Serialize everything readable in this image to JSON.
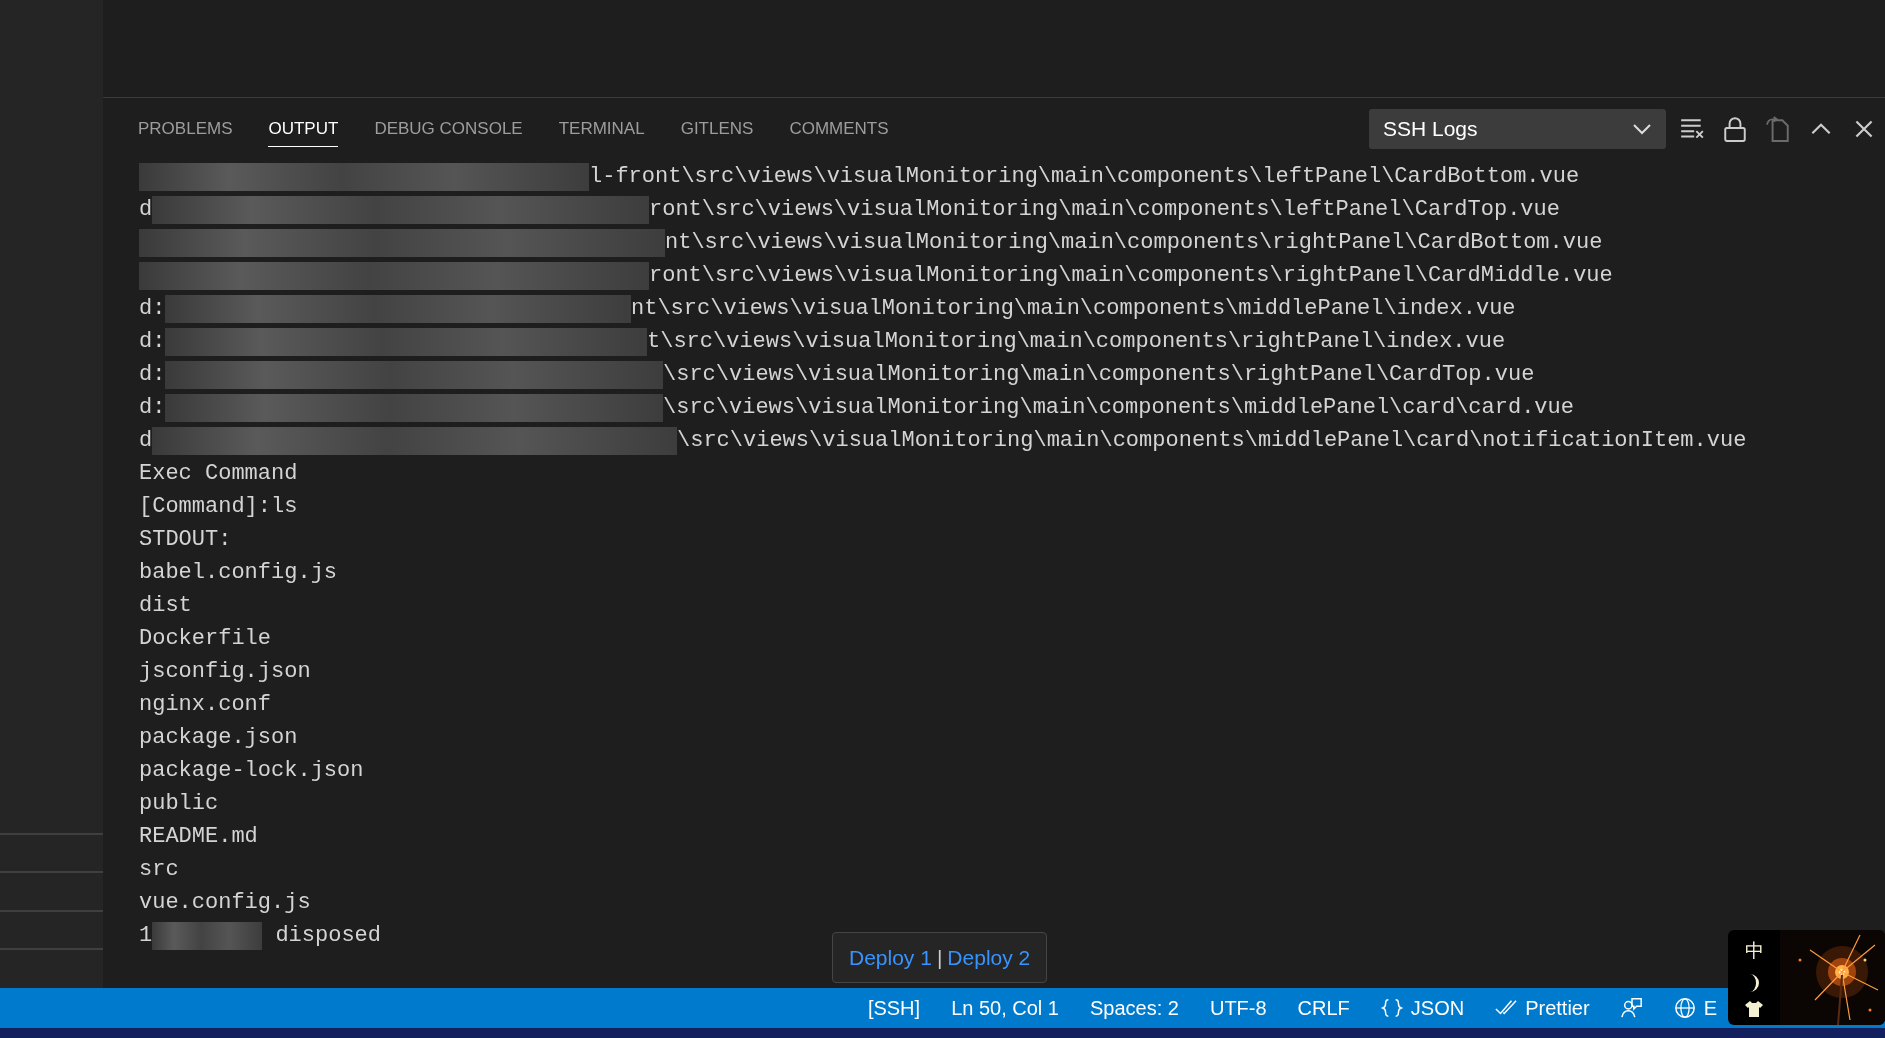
{
  "panel": {
    "tabs": [
      {
        "label": "PROBLEMS",
        "selected": false
      },
      {
        "label": "OUTPUT",
        "selected": true
      },
      {
        "label": "DEBUG CONSOLE",
        "selected": false
      },
      {
        "label": "TERMINAL",
        "selected": false
      },
      {
        "label": "GITLENS",
        "selected": false
      },
      {
        "label": "COMMENTS",
        "selected": false
      }
    ],
    "channel_select": {
      "value": "SSH Logs"
    },
    "actions": [
      {
        "kind": "clear",
        "disabled": false
      },
      {
        "kind": "lock",
        "disabled": false
      },
      {
        "kind": "open-editor",
        "disabled": true
      },
      {
        "kind": "maximize",
        "disabled": false
      },
      {
        "kind": "close",
        "disabled": false
      }
    ]
  },
  "output": [
    {
      "redacted": true,
      "text": "l-front\\src\\views\\visualMonitoring\\main\\components\\leftPanel\\CardBottom.vue"
    },
    {
      "prefix": "d",
      "redacted": true,
      "text": "ront\\src\\views\\visualMonitoring\\main\\components\\leftPanel\\CardTop.vue"
    },
    {
      "redacted": true,
      "text": "nt\\src\\views\\visualMonitoring\\main\\components\\rightPanel\\CardBottom.vue"
    },
    {
      "redacted": true,
      "text": "ront\\src\\views\\visualMonitoring\\main\\components\\rightPanel\\CardMiddle.vue"
    },
    {
      "prefix": "d:",
      "redacted": true,
      "text": "nt\\src\\views\\visualMonitoring\\main\\components\\middlePanel\\index.vue"
    },
    {
      "prefix": "d:",
      "redacted": true,
      "text": "t\\src\\views\\visualMonitoring\\main\\components\\rightPanel\\index.vue"
    },
    {
      "prefix": "d:",
      "redacted": true,
      "text": "\\src\\views\\visualMonitoring\\main\\components\\rightPanel\\CardTop.vue"
    },
    {
      "prefix": "d:",
      "redacted": true,
      "text": "\\src\\views\\visualMonitoring\\main\\components\\middlePanel\\card\\card.vue"
    },
    {
      "prefix": "d",
      "redacted": true,
      "text": "\\src\\views\\visualMonitoring\\main\\components\\middlePanel\\card\\notificationItem.vue"
    },
    {
      "redacted": false,
      "text": "Exec Command"
    },
    {
      "redacted": false,
      "text": "[Command]:ls"
    },
    {
      "redacted": false,
      "text": "STDOUT:"
    },
    {
      "redacted": false,
      "text": "babel.config.js"
    },
    {
      "redacted": false,
      "text": "dist"
    },
    {
      "redacted": false,
      "text": "Dockerfile"
    },
    {
      "redacted": false,
      "text": "jsconfig.json"
    },
    {
      "redacted": false,
      "text": "nginx.conf"
    },
    {
      "redacted": false,
      "text": "package.json"
    },
    {
      "redacted": false,
      "text": "package-lock.json"
    },
    {
      "redacted": false,
      "text": "public"
    },
    {
      "redacted": false,
      "text": "README.md"
    },
    {
      "redacted": false,
      "text": "src"
    },
    {
      "redacted": false,
      "text": "vue.config.js"
    },
    {
      "prefix": "1",
      "redacted": true,
      "text": " disposed"
    }
  ],
  "tooltip": {
    "links": [
      "Deploy 1",
      "Deploy 2"
    ],
    "separator": "|"
  },
  "status_bar": [
    {
      "kind": "text",
      "label": "[SSH]"
    },
    {
      "kind": "text",
      "label": "Ln 50, Col 1"
    },
    {
      "kind": "text",
      "label": "Spaces: 2"
    },
    {
      "kind": "text",
      "label": "UTF-8"
    },
    {
      "kind": "text",
      "label": "CRLF"
    },
    {
      "kind": "braces",
      "label": "JSON"
    },
    {
      "kind": "check",
      "label": "Prettier"
    },
    {
      "kind": "feedback"
    },
    {
      "kind": "globe",
      "label": "E"
    }
  ],
  "ime": {
    "mode": "中"
  }
}
